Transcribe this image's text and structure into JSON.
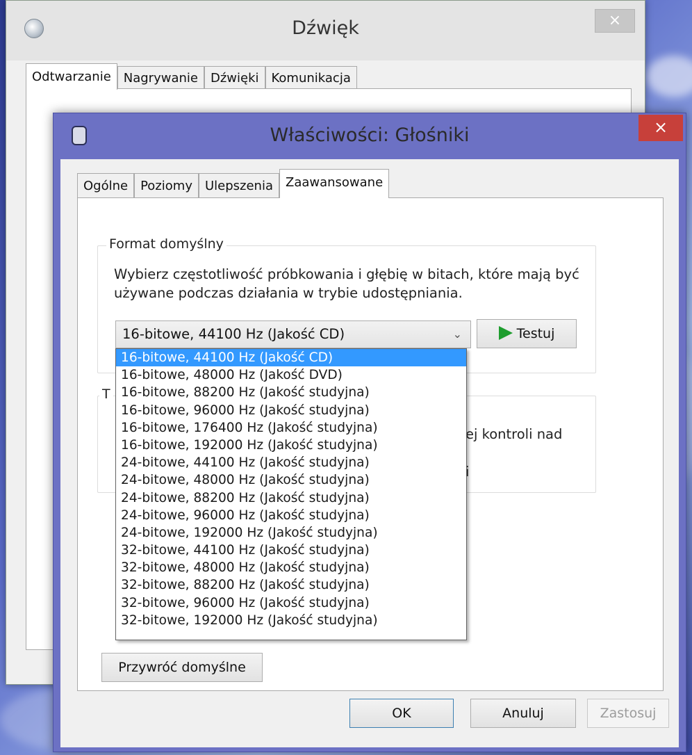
{
  "back_window": {
    "title": "Dźwięk",
    "close_glyph": "×",
    "tabs": [
      {
        "label": "Odtwarzanie",
        "active": true
      },
      {
        "label": "Nagrywanie",
        "active": false
      },
      {
        "label": "Dźwięki",
        "active": false
      },
      {
        "label": "Komunikacja",
        "active": false
      }
    ]
  },
  "front_window": {
    "title": "Właściwości: Głośniki",
    "close_glyph": "×",
    "tabs": [
      {
        "label": "Ogólne",
        "active": false
      },
      {
        "label": "Poziomy",
        "active": false
      },
      {
        "label": "Ulepszenia",
        "active": false
      },
      {
        "label": "Zaawansowane",
        "active": true
      }
    ],
    "default_format": {
      "legend": "Format domyślny",
      "description": "Wybierz częstotliwość próbkowania i głębię w bitach, które mają być używane podczas działania w trybie udostępniania.",
      "selected_value": "16-bitowe, 44100 Hz (Jakość CD)",
      "dropdown_arrow": "⌄",
      "test_button": "Testuj",
      "options": [
        "16-bitowe, 44100 Hz (Jakość CD)",
        "16-bitowe, 48000 Hz (Jakość DVD)",
        "16-bitowe, 88200 Hz (Jakość studyjna)",
        "16-bitowe, 96000 Hz (Jakość studyjna)",
        "16-bitowe, 176400 Hz (Jakość studyjna)",
        "16-bitowe, 192000 Hz (Jakość studyjna)",
        "24-bitowe, 44100 Hz (Jakość studyjna)",
        "24-bitowe, 48000 Hz (Jakość studyjna)",
        "24-bitowe, 88200 Hz (Jakość studyjna)",
        "24-bitowe, 96000 Hz (Jakość studyjna)",
        "24-bitowe, 192000 Hz (Jakość studyjna)",
        "32-bitowe, 44100 Hz (Jakość studyjna)",
        "32-bitowe, 48000 Hz (Jakość studyjna)",
        "32-bitowe, 88200 Hz (Jakość studyjna)",
        "32-bitowe, 96000 Hz (Jakość studyjna)",
        "32-bitowe, 192000 Hz (Jakość studyjna)"
      ],
      "selected_index": 0
    },
    "exclusive_mode": {
      "legend_fragment": "T",
      "text_fragment_1": "ej kontroli nad",
      "text_fragment_2": "i"
    },
    "restore_defaults_button": "Przywróć domyślne",
    "footer": {
      "ok": "OK",
      "cancel": "Anuluj",
      "apply": "Zastosuj"
    }
  },
  "colors": {
    "front_frame": "#6c71c4",
    "close_button": "#c7403a",
    "selection": "#3399ff",
    "play_icon": "#1e9d2e"
  }
}
